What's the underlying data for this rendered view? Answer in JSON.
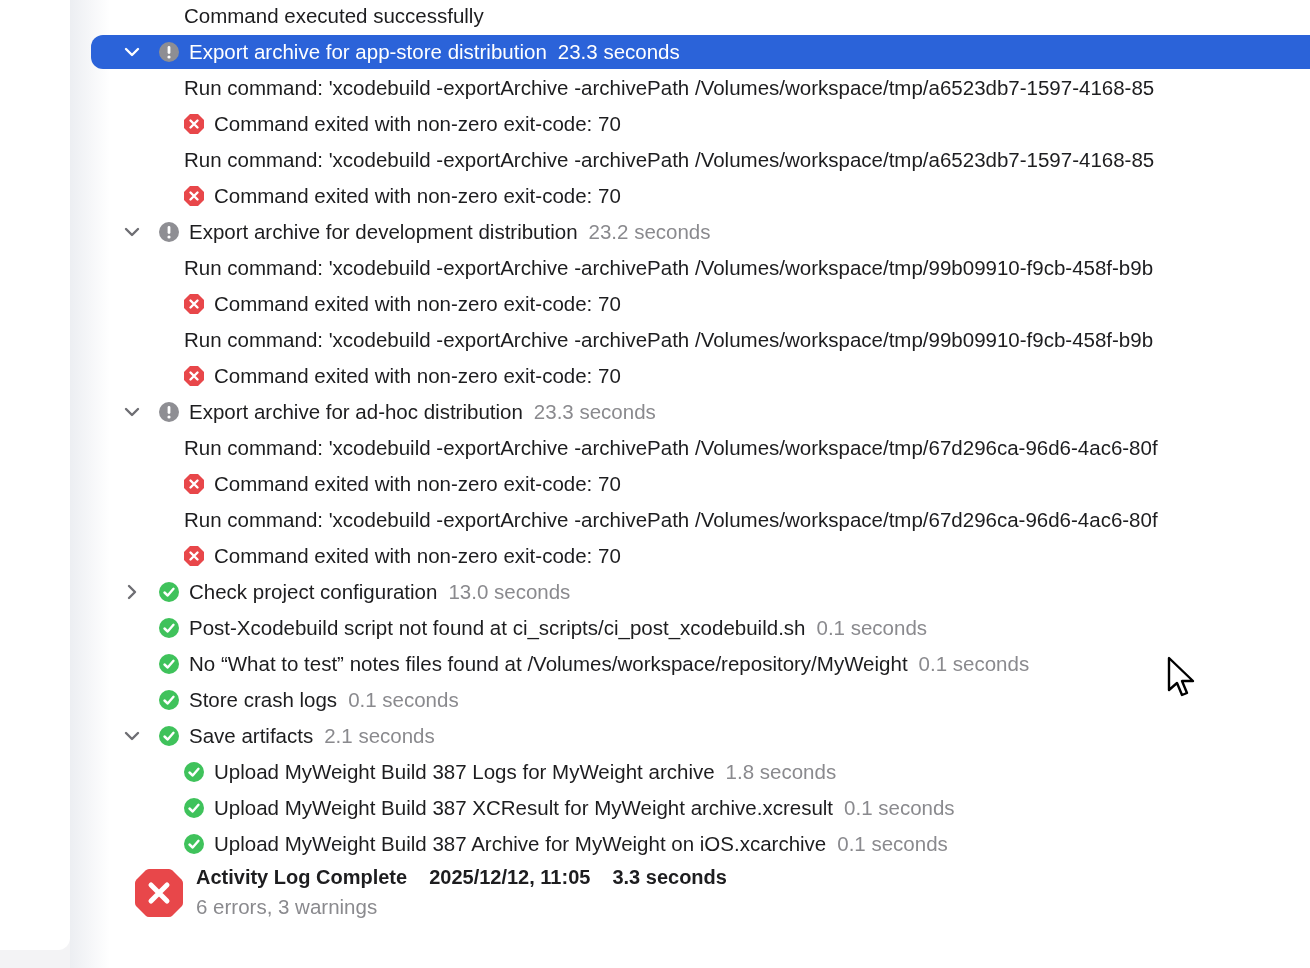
{
  "steps": [
    {
      "kind": "line",
      "text": "Command executed successfully"
    },
    {
      "kind": "warning",
      "title": "Export archive for app-store distribution",
      "duration": "23.3 seconds",
      "expanded": true,
      "selected": true,
      "children": [
        {
          "kind": "plain",
          "text": "Run command: 'xcodebuild -exportArchive -archivePath /Volumes/workspace/tmp/a6523db7-1597-4168-85"
        },
        {
          "kind": "error",
          "text": "Command exited with non-zero exit-code: 70"
        },
        {
          "kind": "plain",
          "text": "Run command: 'xcodebuild -exportArchive -archivePath /Volumes/workspace/tmp/a6523db7-1597-4168-85"
        },
        {
          "kind": "error",
          "text": "Command exited with non-zero exit-code: 70"
        }
      ]
    },
    {
      "kind": "warning",
      "title": "Export archive for development distribution",
      "duration": "23.2 seconds",
      "expanded": true,
      "selected": false,
      "children": [
        {
          "kind": "plain",
          "text": "Run command: 'xcodebuild -exportArchive -archivePath /Volumes/workspace/tmp/99b09910-f9cb-458f-b9b"
        },
        {
          "kind": "error",
          "text": "Command exited with non-zero exit-code: 70"
        },
        {
          "kind": "plain",
          "text": "Run command: 'xcodebuild -exportArchive -archivePath /Volumes/workspace/tmp/99b09910-f9cb-458f-b9b"
        },
        {
          "kind": "error",
          "text": "Command exited with non-zero exit-code: 70"
        }
      ]
    },
    {
      "kind": "warning",
      "title": "Export archive for ad-hoc distribution",
      "duration": "23.3 seconds",
      "expanded": true,
      "selected": false,
      "children": [
        {
          "kind": "plain",
          "text": "Run command: 'xcodebuild -exportArchive -archivePath /Volumes/workspace/tmp/67d296ca-96d6-4ac6-80f"
        },
        {
          "kind": "error",
          "text": "Command exited with non-zero exit-code: 70"
        },
        {
          "kind": "plain",
          "text": "Run command: 'xcodebuild -exportArchive -archivePath /Volumes/workspace/tmp/67d296ca-96d6-4ac6-80f"
        },
        {
          "kind": "error",
          "text": "Command exited with non-zero exit-code: 70"
        }
      ]
    },
    {
      "kind": "success",
      "title": "Check project configuration",
      "duration": "13.0 seconds",
      "expanded": false,
      "selected": false
    },
    {
      "kind": "success",
      "title": "Post-Xcodebuild script not found at ci_scripts/ci_post_xcodebuild.sh",
      "duration": "0.1 seconds",
      "selected": false
    },
    {
      "kind": "success",
      "title": "No “What to test” notes files found at /Volumes/workspace/repository/MyWeight",
      "duration": "0.1 seconds",
      "selected": false
    },
    {
      "kind": "success",
      "title": "Store crash logs",
      "duration": "0.1 seconds",
      "selected": false
    },
    {
      "kind": "success",
      "title": "Save artifacts",
      "duration": "2.1 seconds",
      "expanded": true,
      "selected": false,
      "children": [
        {
          "kind": "success",
          "text": "Upload MyWeight Build 387 Logs for MyWeight archive",
          "duration": "1.8 seconds"
        },
        {
          "kind": "success",
          "text": "Upload MyWeight Build 387 XCResult for MyWeight archive.xcresult",
          "duration": "0.1 seconds"
        },
        {
          "kind": "success",
          "text": "Upload MyWeight Build 387 Archive for MyWeight on iOS.xcarchive",
          "duration": "0.1 seconds"
        }
      ]
    }
  ],
  "summary": {
    "kind": "error",
    "title": "Activity Log Complete",
    "date": "2025/12/12, 11:05",
    "duration": "3.3 seconds",
    "counts": "6 errors, 3 warnings"
  }
}
